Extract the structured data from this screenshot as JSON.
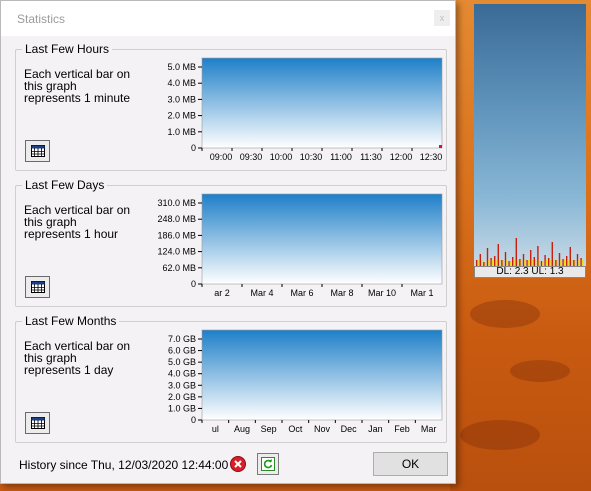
{
  "window": {
    "title": "Statistics",
    "close_label": "x"
  },
  "desktop": {
    "status_text": "DL: 2.3 UL: 1.3"
  },
  "groups": [
    {
      "title": "Last Few Hours",
      "description": "Each vertical bar on this graph represents 1 minute"
    },
    {
      "title": "Last Few Days",
      "description": "Each vertical bar on this graph represents 1 hour"
    },
    {
      "title": "Last Few Months",
      "description": "Each vertical bar on this graph represents 1 day"
    }
  ],
  "footer": {
    "history": "History since Thu, 12/03/2020 12:44:00",
    "ok_label": "OK"
  },
  "colors": {
    "plot_top": "#1e7fc8",
    "plot_bottom": "#ffffff",
    "data_marker": "#e0102a"
  },
  "chart_data": [
    {
      "type": "bar",
      "title": "Last Few Hours",
      "y_ticks": [
        "5.0 MB",
        "4.0 MB",
        "3.0 MB",
        "2.0 MB",
        "1.0 MB",
        "0"
      ],
      "x_ticks": [
        "09:00",
        "09:30",
        "10:00",
        "10:30",
        "11:00",
        "11:30",
        "12:00",
        "12:30"
      ],
      "values": []
    },
    {
      "type": "bar",
      "title": "Last Few Days",
      "y_ticks": [
        "310.0 MB",
        "248.0 MB",
        "186.0 MB",
        "124.0 MB",
        "62.0 MB",
        "0"
      ],
      "x_ticks": [
        "ar 2",
        "Mar 4",
        "Mar 6",
        "Mar 8",
        "Mar 10",
        "Mar 1"
      ],
      "values": []
    },
    {
      "type": "bar",
      "title": "Last Few Months",
      "y_ticks": [
        "7.0 GB",
        "6.0 GB",
        "5.0 GB",
        "4.0 GB",
        "3.0 GB",
        "2.0 GB",
        "1.0 GB",
        "0"
      ],
      "x_ticks": [
        "ul",
        "Aug",
        "Sep",
        "Oct",
        "Nov",
        "Dec",
        "Jan",
        "Feb",
        "Mar"
      ],
      "values": []
    }
  ]
}
